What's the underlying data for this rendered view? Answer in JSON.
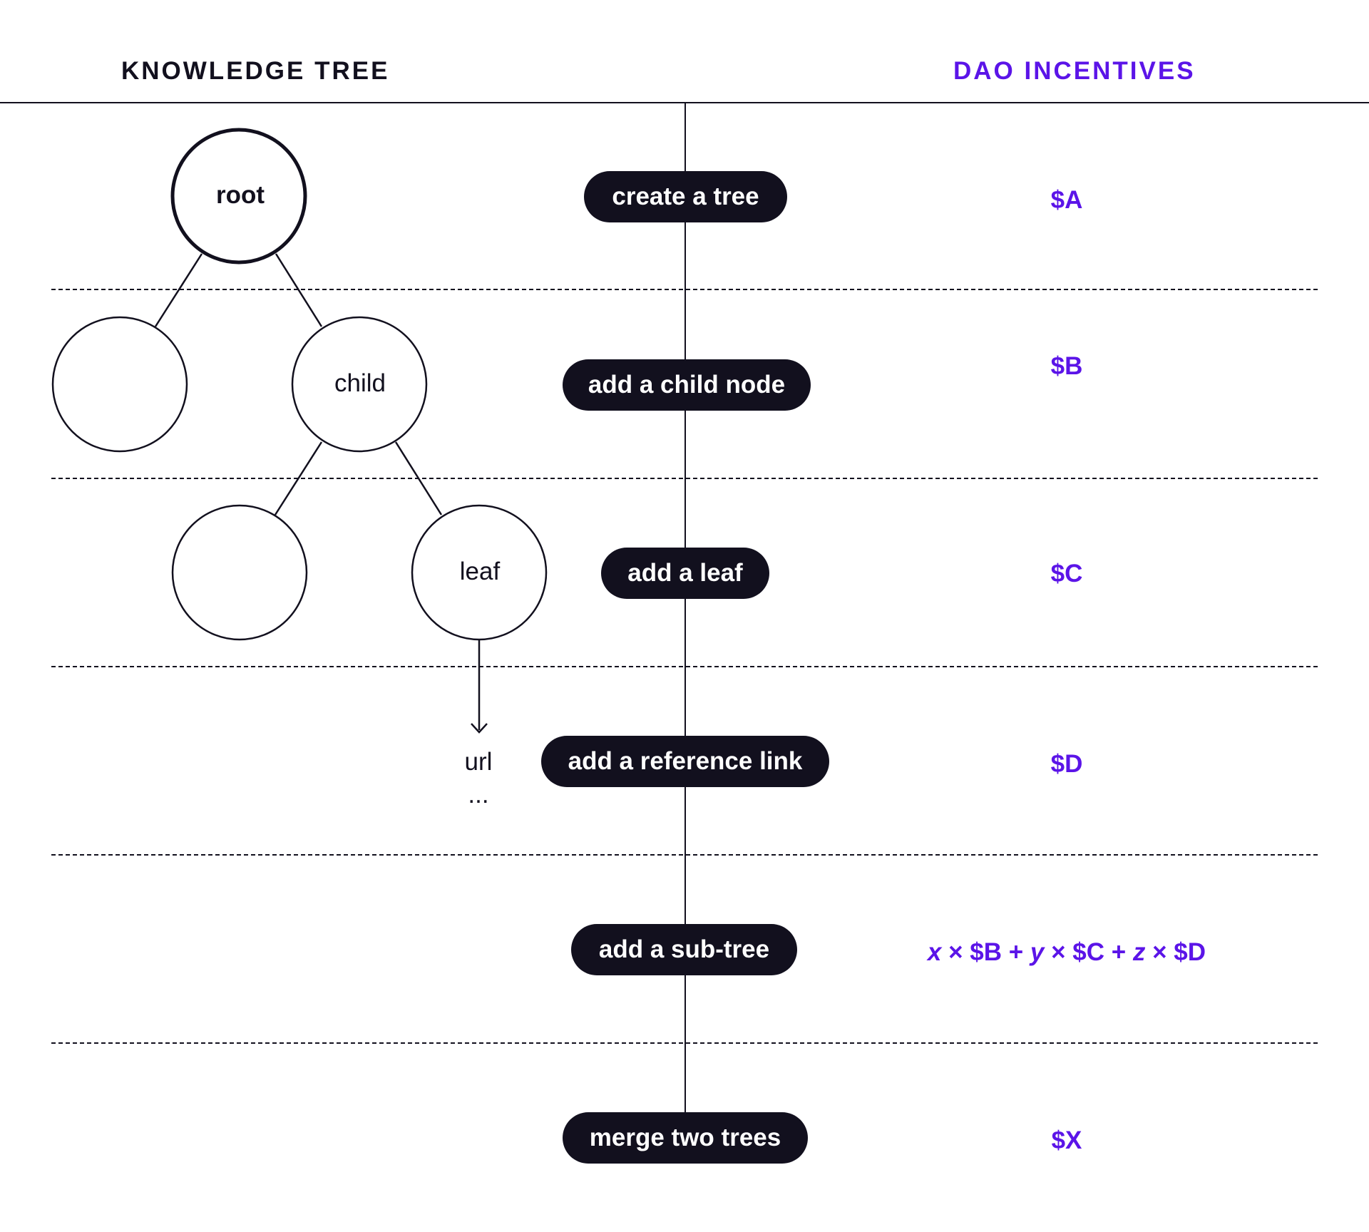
{
  "header": {
    "left_title": "KNOWLEDGE TREE",
    "right_title": "DAO INCENTIVES"
  },
  "tree": {
    "root_label": "root",
    "child_label": "child",
    "leaf_label": "leaf",
    "url_label": "url",
    "ellipsis": "..."
  },
  "actions": [
    {
      "label": "create a tree",
      "incentive": "$A"
    },
    {
      "label": "add a child node",
      "incentive": "$B"
    },
    {
      "label": "add a leaf",
      "incentive": "$C"
    },
    {
      "label": "add a reference link",
      "incentive": "$D"
    },
    {
      "label": "add a sub-tree",
      "incentive_formula": {
        "x": "x",
        "times1": " × $B + ",
        "y": "y",
        "times2": " × $C + ",
        "z": "z",
        "times3": " × $D"
      }
    },
    {
      "label": "merge two trees",
      "incentive": "$X"
    }
  ],
  "colors": {
    "ink": "#12101e",
    "accent": "#5b14e8",
    "background": "#ffffff"
  }
}
